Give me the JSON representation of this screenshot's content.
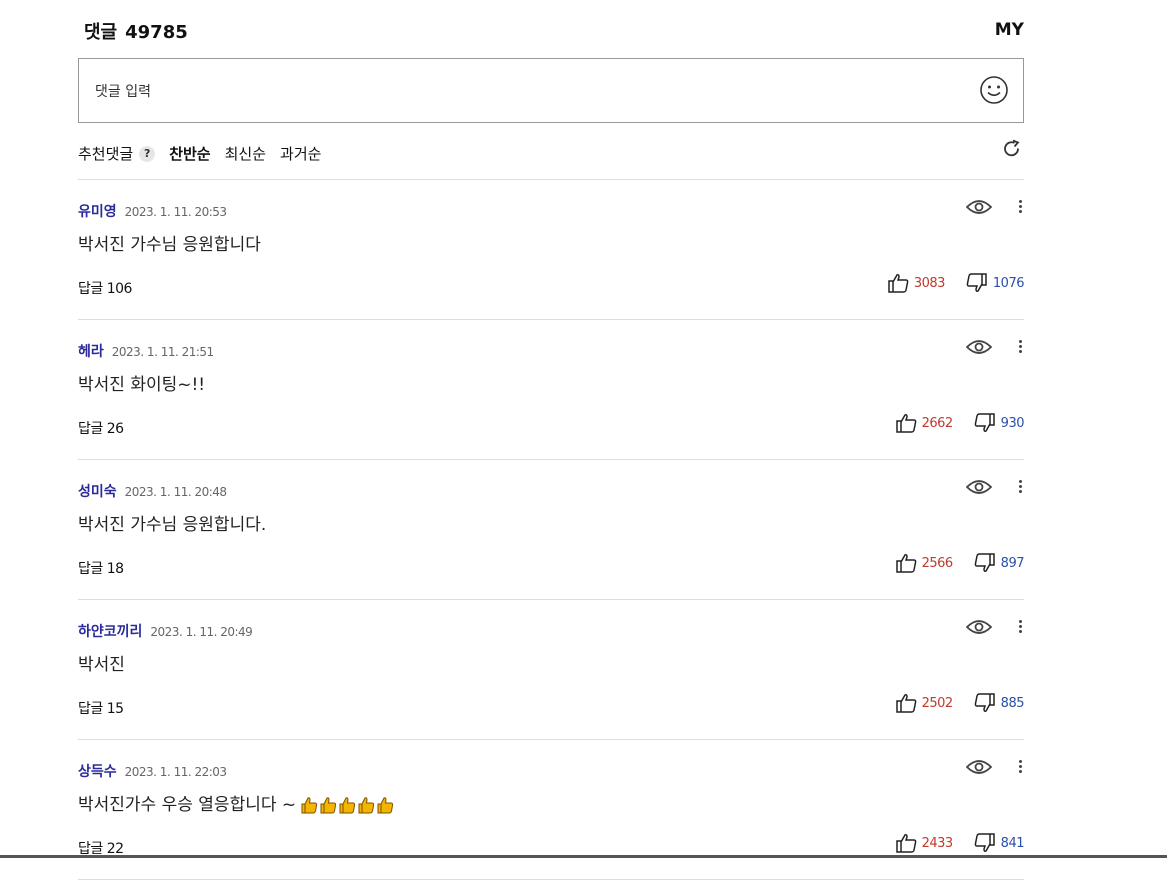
{
  "header": {
    "title": "댓글",
    "count": "49785",
    "my_label": "MY"
  },
  "input": {
    "placeholder": "댓글 입력"
  },
  "sort": {
    "recommended_label": "추천댓글",
    "help": "?",
    "options": [
      {
        "label": "찬반순",
        "active": true
      },
      {
        "label": "최신순",
        "active": false
      },
      {
        "label": "과거순",
        "active": false
      }
    ]
  },
  "comments": [
    {
      "author": "유미영",
      "date": "2023. 1. 11. 20:53",
      "text": "박서진 가수님 응원합니다",
      "reply": "답글 106",
      "likes": "3083",
      "dislikes": "1076"
    },
    {
      "author": "헤라",
      "date": "2023. 1. 11. 21:51",
      "text": "박서진 화이팅~!!",
      "reply": "답글 26",
      "likes": "2662",
      "dislikes": "930"
    },
    {
      "author": "성미숙",
      "date": "2023. 1. 11. 20:48",
      "text": "박서진 가수님 응원합니다.",
      "reply": "답글 18",
      "likes": "2566",
      "dislikes": "897"
    },
    {
      "author": "하얀코끼리",
      "date": "2023. 1. 11. 20:49",
      "text": "박서진",
      "reply": "답글 15",
      "likes": "2502",
      "dislikes": "885"
    },
    {
      "author": "상득수",
      "date": "2023. 1. 11. 22:03",
      "text": "박서진가수 우승 열응합니다 ~",
      "reply": "답글 22",
      "likes": "2433",
      "dislikes": "841",
      "emoji_count": 5
    }
  ],
  "colors": {
    "author": "#2b2b9a",
    "like": "#c0392b",
    "dislike": "#2a4fa8"
  }
}
